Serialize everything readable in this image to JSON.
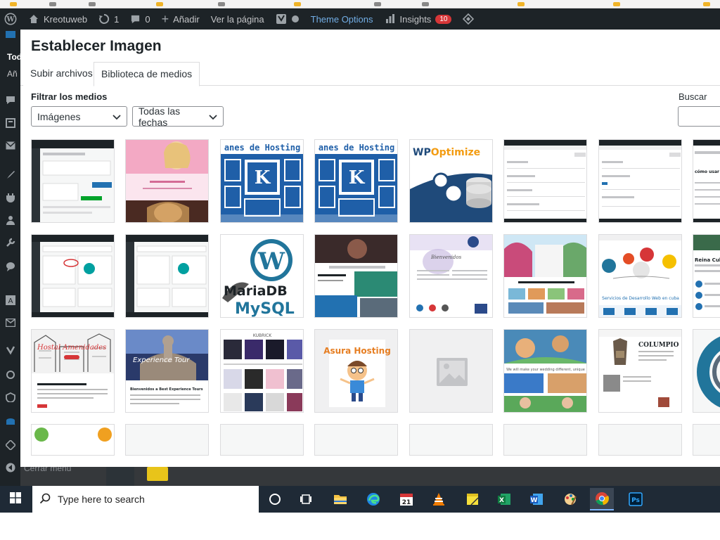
{
  "admin_bar": {
    "site_name": "Kreotuweb",
    "updates_count": "1",
    "comments_count": "0",
    "new_label": "Añadir",
    "view_page": "Ver la página",
    "theme_options": "Theme Options",
    "insights": "Insights",
    "insights_badge": "10"
  },
  "sidebar": {
    "partial_text_1": "Tod",
    "partial_text_2": "Añ",
    "collapse_label": "Cerrar menú"
  },
  "modal": {
    "title": "Establecer Imagen",
    "tabs": [
      {
        "label": "Subir archivos",
        "active": false
      },
      {
        "label": "Biblioteca de medios",
        "active": true
      }
    ],
    "filter_label": "Filtrar los medios",
    "type_filter": "Imágenes",
    "date_filter": "Todas las fechas",
    "search_label": "Buscar",
    "search_value": ""
  },
  "media_thumbs": [
    {
      "name": "thumb-admin-screenshot",
      "icon": "admin-screenshot"
    },
    {
      "name": "thumb-woman-photo",
      "icon": "portrait-photo",
      "text": "Peluquería y Barbería · ANIMATE A UN NUEVO RECORRIDO"
    },
    {
      "name": "thumb-hosting-planes-1",
      "text": "Planes de Hosting"
    },
    {
      "name": "thumb-hosting-planes-2",
      "text": "Planes de Hosting"
    },
    {
      "name": "thumb-wp-optimize",
      "text": "WP Optimize"
    },
    {
      "name": "thumb-settings-screenshot-1",
      "icon": "settings-page"
    },
    {
      "name": "thumb-settings-screenshot-2",
      "icon": "settings-page"
    },
    {
      "name": "thumb-plugin-page-partial",
      "text": "cómo usar WP-Optimize"
    },
    {
      "name": "thumb-plugin-install-1",
      "icon": "plugins-page"
    },
    {
      "name": "thumb-plugin-install-2",
      "icon": "plugins-page"
    },
    {
      "name": "thumb-wordpress-mariadb",
      "text": "MariaDB MySQL"
    },
    {
      "name": "thumb-dark-website",
      "icon": "website"
    },
    {
      "name": "thumb-bienvenidos-site",
      "text": "Bienvenidos"
    },
    {
      "name": "thumb-beach-site",
      "icon": "website"
    },
    {
      "name": "thumb-web-dev-services",
      "text": "Servicios de Desarrollo Web en cuba"
    },
    {
      "name": "thumb-reina-cuba",
      "text": "Reina Cuba"
    },
    {
      "name": "thumb-hostal-amenidades",
      "text": "Hostal Amenidades"
    },
    {
      "name": "thumb-experience-tours",
      "text": "Experience Tour · Bienvenidos a Best Experience Tours"
    },
    {
      "name": "thumb-kubrick-themes",
      "text": "KUBRICK"
    },
    {
      "name": "thumb-asura-hosting",
      "text": "Asura Hosting"
    },
    {
      "name": "thumb-placeholder",
      "icon": "image-placeholder"
    },
    {
      "name": "thumb-travel-site",
      "text": "We will make your wedding different, unique"
    },
    {
      "name": "thumb-columpio",
      "text": "COLUMPIO"
    },
    {
      "name": "thumb-ring-partial",
      "icon": "ring-graphic"
    }
  ],
  "taskbar": {
    "search_placeholder": "Type here to search",
    "apps": [
      "cortana-icon",
      "task-view-icon",
      "file-explorer-icon",
      "edge-icon",
      "calendar-app-icon",
      "vlc-icon",
      "sticky-notes-icon",
      "excel-icon",
      "word-icon",
      "paint-icon",
      "chrome-icon",
      "photoshop-icon"
    ],
    "active_app": "chrome-icon",
    "calendar_day": "21"
  }
}
